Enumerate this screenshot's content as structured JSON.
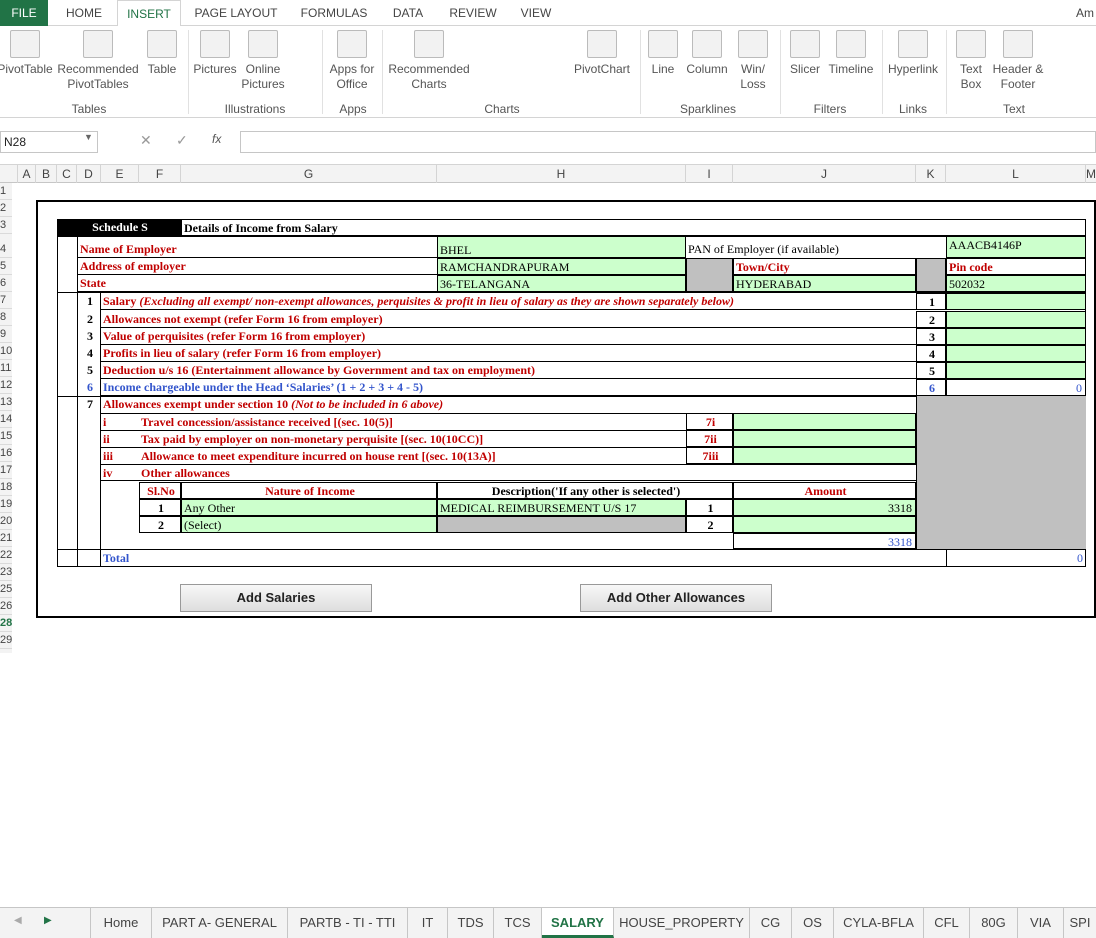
{
  "ribbon": {
    "tabs": [
      "FILE",
      "HOME",
      "INSERT",
      "PAGE LAYOUT",
      "FORMULAS",
      "DATA",
      "REVIEW",
      "VIEW"
    ],
    "user": "Am",
    "buttons": [
      "PivotTable",
      "Recommended PivotTables",
      "Table",
      "Pictures",
      "Online Pictures",
      "Apps for Office",
      "Recommended Charts",
      "PivotChart",
      "Line",
      "Column",
      "Win/ Loss",
      "Slicer",
      "Timeline",
      "Hyperlink",
      "Text Box",
      "Header & Footer"
    ],
    "groups": [
      "Tables",
      "Illustrations",
      "Apps",
      "Charts",
      "Sparklines",
      "Filters",
      "Links",
      "Text"
    ]
  },
  "formula_bar": {
    "name_box": "N28",
    "fx_icon": "fx",
    "formula": ""
  },
  "columns": [
    "A",
    "B",
    "C",
    "D",
    "E",
    "F",
    "G",
    "H",
    "I",
    "J",
    "K",
    "L",
    "M"
  ],
  "rows": [
    "1",
    "2",
    "3",
    "4",
    "5",
    "6",
    "7",
    "8",
    "9",
    "10",
    "11",
    "12",
    "13",
    "14",
    "15",
    "16",
    "17",
    "18",
    "19",
    "20",
    "21",
    "22",
    "23",
    "25",
    "26",
    "28",
    "29"
  ],
  "schedule": {
    "title": "Schedule S",
    "subtitle": "Details of Income from Salary",
    "employer_label": "Name of Employer",
    "employer": "BHEL",
    "pan_label": "PAN of Employer (if available)",
    "pan": "AAACB4146P",
    "address_label": "Address of employer",
    "address": "RAMCHANDRAPURAM",
    "town_label": "Town/City",
    "pin_label": "Pin code",
    "state_label": "State",
    "state": "36-TELANGANA",
    "town": "HYDERABAD",
    "pin": "502032",
    "items": [
      {
        "no": "1",
        "label": "Salary",
        "note": " (Excluding all exempt/ non-exempt  allowances, perquisites & profit in lieu of salary as they are shown separately below)",
        "ref": "1",
        "value": ""
      },
      {
        "no": "2",
        "label": "Allowances not exempt (refer Form 16 from employer)",
        "note": "",
        "ref": "2",
        "value": ""
      },
      {
        "no": "3",
        "label": "Value of perquisites (refer Form 16 from employer)",
        "note": "",
        "ref": "3",
        "value": ""
      },
      {
        "no": "4",
        "label": "Profits in lieu of salary (refer Form 16 from employer)",
        "note": "",
        "ref": "4",
        "value": ""
      },
      {
        "no": "5",
        "label": "Deduction u/s 16 (Entertainment allowance by Government and tax on employment)",
        "note": "",
        "ref": "5",
        "value": ""
      }
    ],
    "item6": {
      "no": "6",
      "label": "Income chargeable under the Head ‘Salaries’ (1 + 2 + 3 + 4 - 5)",
      "ref": "6",
      "value": "0"
    },
    "item7": {
      "no": "7",
      "label": "Allowances exempt under section 10",
      "note": " (Not to be included in 6 above)"
    },
    "sub": [
      {
        "roman": "i",
        "label": "Travel concession/assistance received [(sec. 10(5)]",
        "ref": "7i"
      },
      {
        "roman": "ii",
        "label": "Tax paid by employer on non-monetary perquisite [(sec. 10(10CC)]",
        "ref": "7ii"
      },
      {
        "roman": "iii",
        "label": "Allowance to meet expenditure incurred on house rent [(sec. 10(13A)]",
        "ref": "7iii"
      },
      {
        "roman": "iv",
        "label": "Other allowances",
        "ref": ""
      }
    ],
    "other_headers": {
      "slno": "Sl.No",
      "nature": "Nature of Income",
      "desc": "Description('If any other is selected')",
      "amount": "Amount"
    },
    "other_rows": [
      {
        "sl": "1",
        "nature": "Any Other",
        "desc": "MEDICAL REIMBURSEMENT U/S 17",
        "ref": "1",
        "amount": "3318"
      },
      {
        "sl": "2",
        "nature": "(Select)",
        "desc": "",
        "ref": "2",
        "amount": ""
      }
    ],
    "other_total": "3318",
    "total_label": "Total",
    "total_value": "0"
  },
  "buttons": {
    "add_salaries": "Add Salaries",
    "add_allowances": "Add Other Allowances"
  },
  "sheet_tabs": [
    "Home",
    "PART A- GENERAL",
    "PARTB - TI - TTI",
    "IT",
    "TDS",
    "TCS",
    "SALARY",
    "HOUSE_PROPERTY",
    "CG",
    "OS",
    "CYLA-BFLA",
    "CFL",
    "80G",
    "VIA",
    "SPI"
  ],
  "active_sheet": "SALARY"
}
